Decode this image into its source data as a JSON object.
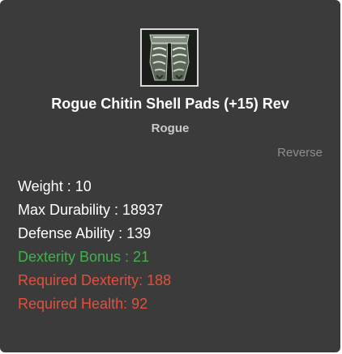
{
  "item": {
    "icon": "chitin-shell-pads-icon",
    "name": "Rogue Chitin Shell Pads (+15) Rev",
    "class": "Rogue",
    "tag": "Reverse"
  },
  "stats": [
    {
      "text": "Weight : 10",
      "color": "#ffffff"
    },
    {
      "text": "Max Durability : 18937",
      "color": "#ffffff"
    },
    {
      "text": "Defense Ability : 139",
      "color": "#ffffff"
    },
    {
      "text": "Dexterity Bonus : 21",
      "color": "#3fb24a"
    },
    {
      "text": "Required Dexterity: 188",
      "color": "#e0513d"
    },
    {
      "text": "Required Health: 92",
      "color": "#e0513d"
    }
  ],
  "colors": {
    "panel": "#3b3b3b",
    "title": "#ffffff",
    "subtitle": "#c9c9c9",
    "tag": "#8e8e8e",
    "bonus": "#3fb24a",
    "requirement": "#e0513d"
  }
}
